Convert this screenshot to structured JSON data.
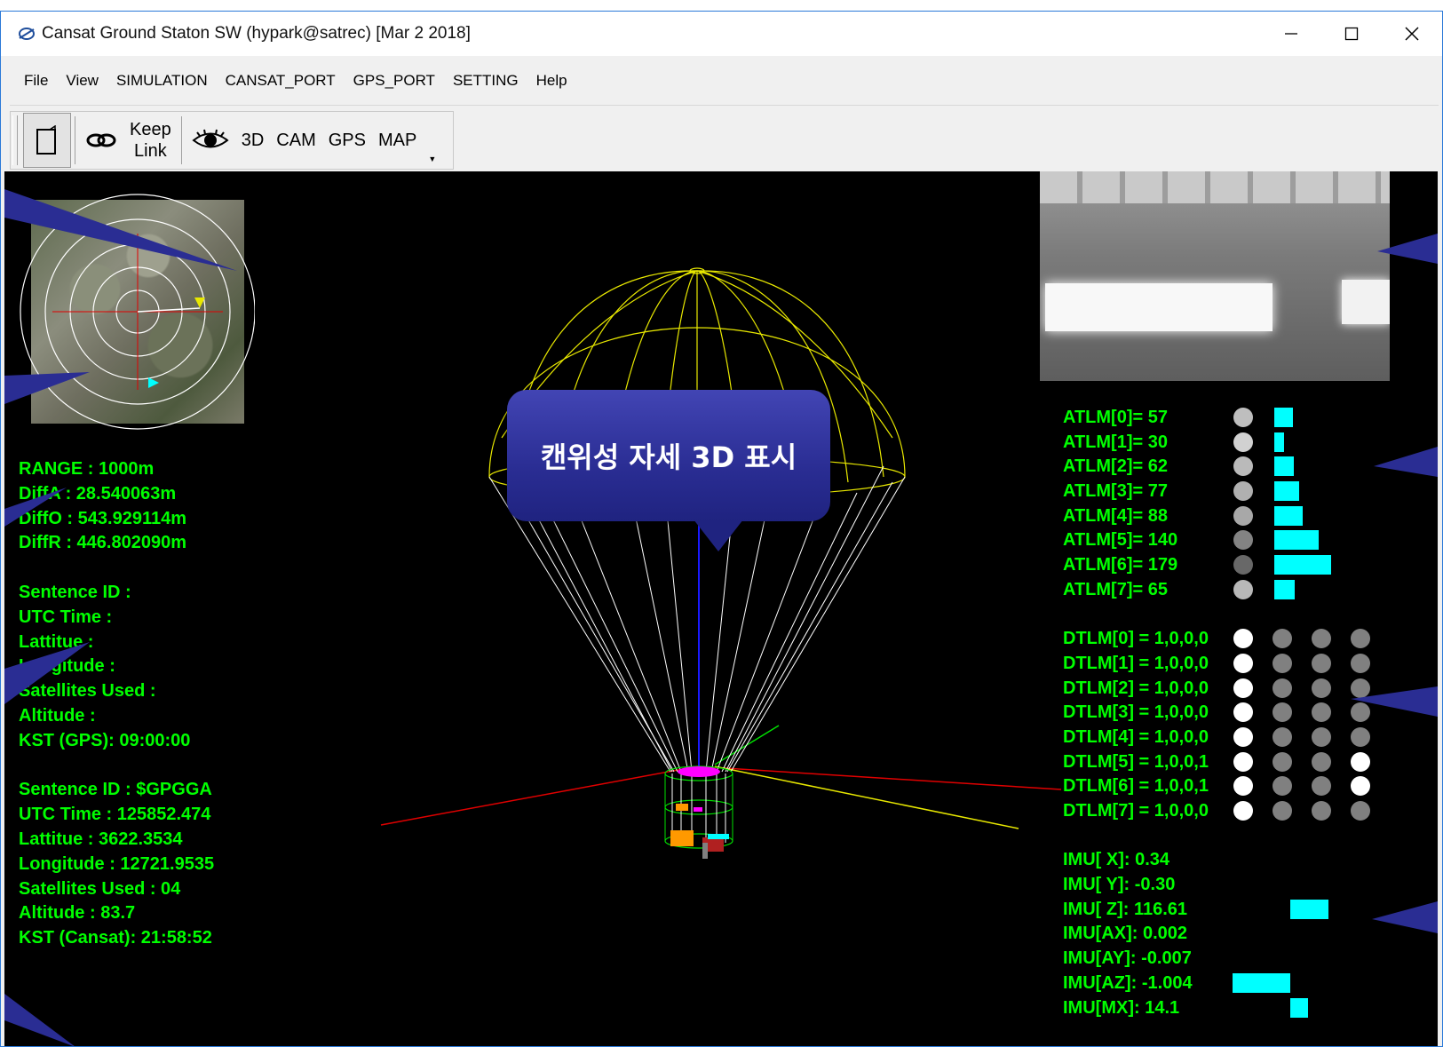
{
  "window": {
    "title": "Cansat Ground Staton SW (hypark@satrec) [Mar  2 2018]"
  },
  "menu": [
    "File",
    "View",
    "SIMULATION",
    "CANSAT_PORT",
    "GPS_PORT",
    "SETTING",
    "Help"
  ],
  "toolbar": {
    "keep_line1": "Keep",
    "keep_line2": "Link",
    "b3d": "3D",
    "cam": "CAM",
    "gps": "GPS",
    "map": "MAP",
    "more": "▼"
  },
  "telemetry_left": {
    "range": "RANGE : 1000m",
    "diffa": "DiffA : 28.540063m",
    "diffo": "DiffO : 543.929114m",
    "diffr": "DiffR : 446.802090m",
    "gps_block": {
      "sentence": "Sentence ID :",
      "utc": "UTC Time :",
      "lat": "Lattitue :",
      "lon": "Longitude :",
      "sats": "Satellites Used :",
      "alt": "Altitude :",
      "kst": "KST (GPS): 09:00:00"
    },
    "cansat_block": {
      "sentence": "Sentence ID : $GPGGA",
      "utc": "UTC Time : 125852.474",
      "lat": "Lattitue : 3622.3534",
      "lon": "Longitude : 12721.9535",
      "sats": "Satellites Used : 04",
      "alt": "Altitude : 83.7",
      "kst": "KST (Cansat): 21:58:52"
    }
  },
  "callout": "캔위성 자세 3D 표시",
  "atlm": [
    {
      "label": "ATLM[0]=  57",
      "value": 57
    },
    {
      "label": "ATLM[1]=  30",
      "value": 30
    },
    {
      "label": "ATLM[2]=  62",
      "value": 62
    },
    {
      "label": "ATLM[3]=  77",
      "value": 77
    },
    {
      "label": "ATLM[4]=  88",
      "value": 88
    },
    {
      "label": "ATLM[5]= 140",
      "value": 140
    },
    {
      "label": "ATLM[6]= 179",
      "value": 179
    },
    {
      "label": "ATLM[7]=  65",
      "value": 65
    }
  ],
  "dtlm": [
    {
      "label": "DTLM[0] = 1,0,0,0",
      "bits": [
        1,
        0,
        0,
        0
      ]
    },
    {
      "label": "DTLM[1] = 1,0,0,0",
      "bits": [
        1,
        0,
        0,
        0
      ]
    },
    {
      "label": "DTLM[2] = 1,0,0,0",
      "bits": [
        1,
        0,
        0,
        0
      ]
    },
    {
      "label": "DTLM[3] = 1,0,0,0",
      "bits": [
        1,
        0,
        0,
        0
      ]
    },
    {
      "label": "DTLM[4] = 1,0,0,0",
      "bits": [
        1,
        0,
        0,
        0
      ]
    },
    {
      "label": "DTLM[5] = 1,0,0,1",
      "bits": [
        1,
        0,
        0,
        1
      ]
    },
    {
      "label": "DTLM[6] = 1,0,0,1",
      "bits": [
        1,
        0,
        0,
        1
      ]
    },
    {
      "label": "DTLM[7] = 1,0,0,0",
      "bits": [
        1,
        0,
        0,
        0
      ]
    }
  ],
  "imu": [
    {
      "label": "IMU[ X]:  0.34",
      "value": 0.34
    },
    {
      "label": "IMU[ Y]: -0.30",
      "value": -0.3
    },
    {
      "label": "IMU[ Z]: 116.61",
      "value": 116.61
    },
    {
      "label": "IMU[AX]: 0.002",
      "value": 0.002
    },
    {
      "label": "IMU[AY]: -0.007",
      "value": -0.007
    },
    {
      "label": "IMU[AZ]: -1.004",
      "value": -1.004
    },
    {
      "label": "IMU[MX]:  14.1",
      "value": 14.1
    }
  ],
  "colors": {
    "telemetry_text": "#00ff00",
    "bar": "#00ffff",
    "callout": "#2a2d93",
    "dot_on": "#ffffff",
    "dot_off": "#808080"
  }
}
